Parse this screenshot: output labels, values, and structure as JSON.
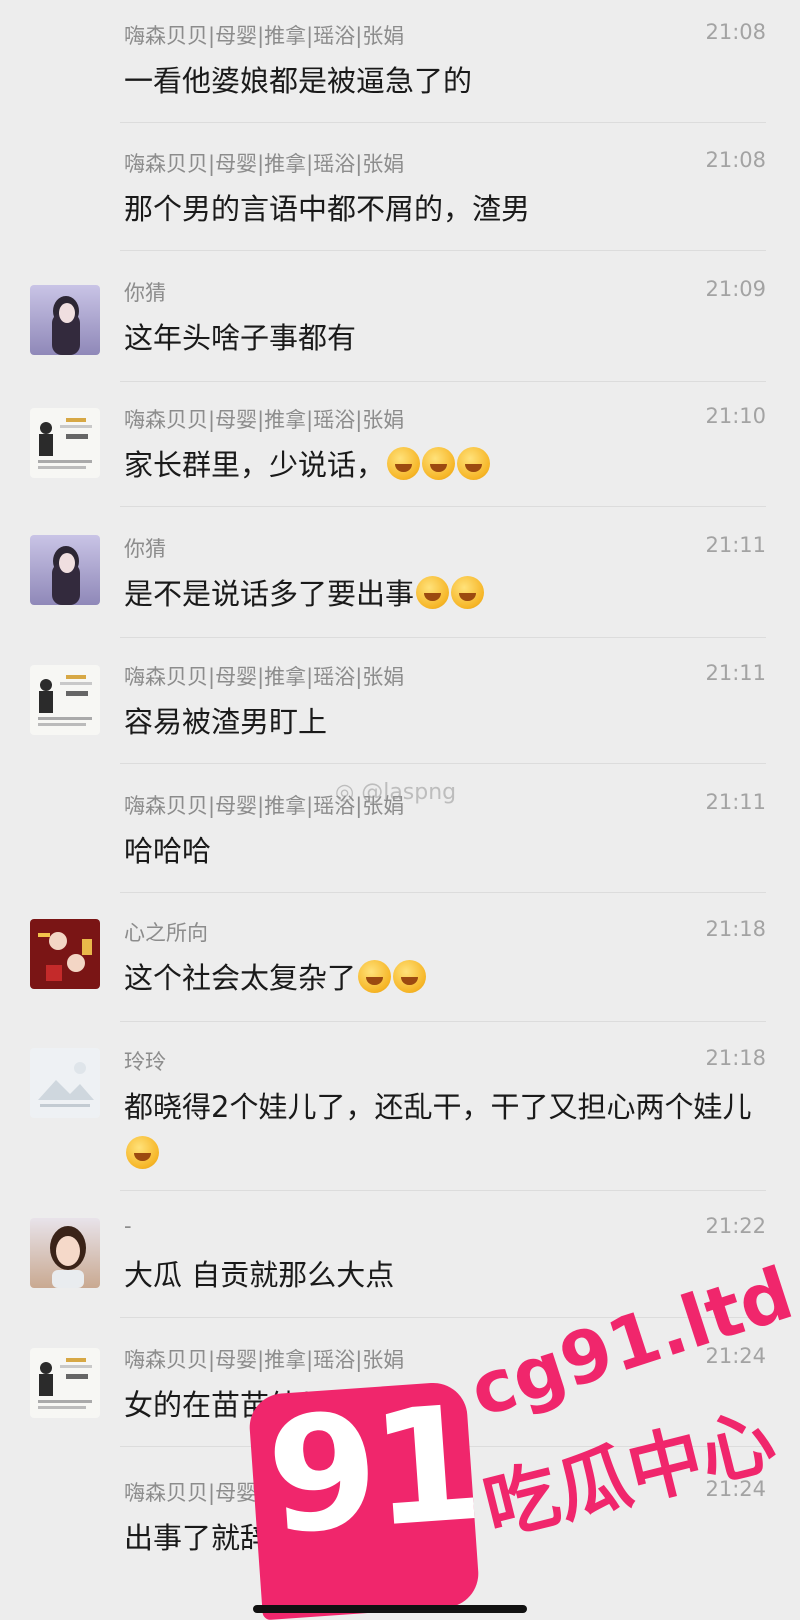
{
  "messages": [
    {
      "sender": "嗨森贝贝|母婴|推拿|瑶浴|张娟",
      "time": "21:08",
      "text": "一看他婆娘都是被逼急了的",
      "emoji_count": 0,
      "avatar": ""
    },
    {
      "sender": "嗨森贝贝|母婴|推拿|瑶浴|张娟",
      "time": "21:08",
      "text": "那个男的言语中都不屑的，渣男",
      "emoji_count": 0,
      "avatar": ""
    },
    {
      "sender": "你猜",
      "time": "21:09",
      "text": "这年头啥子事都有",
      "emoji_count": 0,
      "avatar": "girl-photo"
    },
    {
      "sender": "嗨森贝贝|母婴|推拿|瑶浴|张娟",
      "time": "21:10",
      "text": "家长群里，少说话，",
      "emoji_count": 3,
      "avatar": "business-card"
    },
    {
      "sender": "你猜",
      "time": "21:11",
      "text": "是不是说话多了要出事",
      "emoji_count": 2,
      "avatar": "girl-photo"
    },
    {
      "sender": "嗨森贝贝|母婴|推拿|瑶浴|张娟",
      "time": "21:11",
      "text": "容易被渣男盯上",
      "emoji_count": 0,
      "avatar": "business-card"
    },
    {
      "sender": "嗨森贝贝|母婴|推拿|瑶浴|张娟",
      "time": "21:11",
      "text": "哈哈哈",
      "emoji_count": 0,
      "avatar": ""
    },
    {
      "sender": "心之所向",
      "time": "21:18",
      "text": "这个社会太复杂了",
      "emoji_count": 2,
      "avatar": "red-new-year"
    },
    {
      "sender": "玲玲",
      "time": "21:18",
      "text": "都晓得2个娃儿了，还乱干，干了又担心两个娃儿",
      "emoji_count": 1,
      "avatar": "landscape-placeholder"
    },
    {
      "sender": "-",
      "time": "21:22",
      "text": "大瓜 自贡就那么大点",
      "emoji_count": 0,
      "avatar": "woman-photo"
    },
    {
      "sender": "嗨森贝贝|母婴|推拿|瑶浴|张娟",
      "time": "21:24",
      "text": "女的在苗苗幼儿园上班",
      "emoji_count": 0,
      "avatar": "business-card"
    },
    {
      "sender": "嗨森贝贝|母婴|推拿|瑶浴|张娟",
      "time": "21:24",
      "text": "出事了就辞职了",
      "emoji_count": 0,
      "avatar": ""
    }
  ],
  "watermark": {
    "weibo": "@laspng",
    "number": "91",
    "domain": "cg91.ltd",
    "title": "吃瓜中心"
  },
  "colors": {
    "background": "#ededed",
    "brand_pink": "#f0266c"
  }
}
